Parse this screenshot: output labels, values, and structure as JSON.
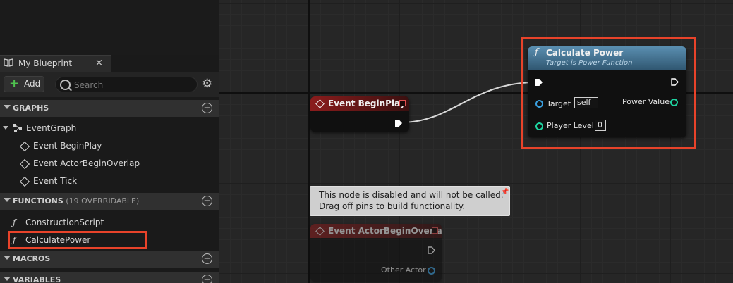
{
  "panel": {
    "tab_label": "My Blueprint",
    "tab_close": "×",
    "add_label": "Add",
    "search_placeholder": "Search"
  },
  "sections": {
    "graphs": "GRAPHS",
    "functions": "FUNCTIONS",
    "functions_sub": " (19 OVERRIDABLE)",
    "macros": "MACROS",
    "variables": "VARIABLES"
  },
  "graphs": {
    "event_graph": "EventGraph",
    "events": [
      "Event BeginPlay",
      "Event ActorBeginOverlap",
      "Event Tick"
    ]
  },
  "functions": [
    "ConstructionScript",
    "CalculatePower"
  ],
  "nodes": {
    "begin_play": {
      "title": "Event BeginPlay"
    },
    "calc_power": {
      "title": "Calculate Power",
      "subtitle": "Target is Power Function",
      "target_label": "Target",
      "target_value": "self",
      "level_label": "Player Level",
      "level_value": "0",
      "output_label": "Power Value"
    },
    "overlap": {
      "title": "Event ActorBeginOverlap",
      "other_actor": "Other Actor"
    }
  },
  "comment": {
    "line1": "This node is disabled and will not be called.",
    "line2": "Drag off pins to build functionality."
  },
  "colors": {
    "highlight": "#e8432a",
    "event_header": "#8b1c1c",
    "function_header": "#4a7896",
    "object_pin": "#3aa0e0",
    "int_pin": "#1ed3a0"
  }
}
